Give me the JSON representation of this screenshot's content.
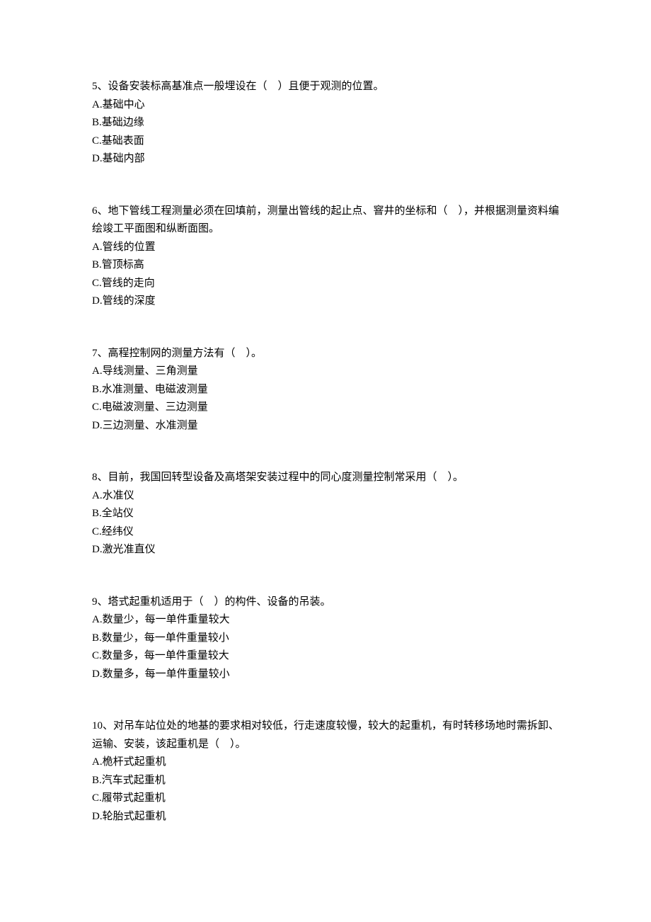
{
  "questions": [
    {
      "stem": "5、设备安装标高基准点一般埋设在（　）且便于观测的位置。",
      "options": [
        "A.基础中心",
        "B.基础边缘",
        "C.基础表面",
        "D.基础内部"
      ]
    },
    {
      "stem": "6、地下管线工程测量必须在回填前，测量出管线的起止点、窨井的坐标和（　），并根据测量资料编绘竣工平面图和纵断面图。",
      "options": [
        "A.管线的位置",
        "B.管顶标高",
        "C.管线的走向",
        "D.管线的深度"
      ]
    },
    {
      "stem": "7、高程控制网的测量方法有（　）。",
      "options": [
        "A.导线测量、三角测量",
        "B.水准测量、电磁波测量",
        "C.电磁波测量、三边测量",
        "D.三边测量、水准测量"
      ]
    },
    {
      "stem": "8、目前，我国回转型设备及高塔架安装过程中的同心度测量控制常采用（　）。",
      "options": [
        "A.水准仪",
        "B.全站仪",
        "C.经纬仪",
        "D.激光准直仪"
      ]
    },
    {
      "stem": "9、塔式起重机适用于（　）的构件、设备的吊装。",
      "options": [
        "A.数量少，每一单件重量较大",
        "B.数量少，每一单件重量较小",
        "C.数量多，每一单件重量较大",
        "D.数量多，每一单件重量较小"
      ]
    },
    {
      "stem": "10、对吊车站位处的地基的要求相对较低，行走速度较慢，较大的起重机，有时转移场地时需拆卸、运输、安装，该起重机是（　）。",
      "options": [
        "A.桅杆式起重机",
        "B.汽车式起重机",
        "C.履带式起重机",
        "D.轮胎式起重机"
      ]
    }
  ]
}
